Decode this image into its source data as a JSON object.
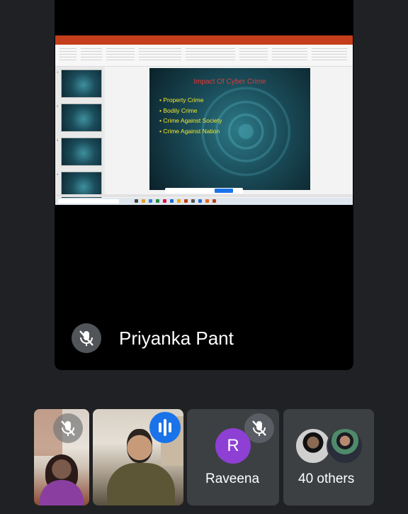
{
  "presenter": {
    "name": "Priyanka Pant",
    "mic_muted": true
  },
  "shared_screen": {
    "app": "PowerPoint",
    "slide": {
      "title": "Impact Of Cyber Crime",
      "bullets": [
        "Property Crime",
        "Bodily Crime",
        "Crime Against Society",
        "Crime Against Nation"
      ]
    },
    "thumbnails": [
      {
        "num": "1"
      },
      {
        "num": "2"
      },
      {
        "num": "3"
      },
      {
        "num": "4"
      }
    ]
  },
  "participants": [
    {
      "type": "photo",
      "mic_muted": true
    },
    {
      "type": "photo",
      "speaking": true
    },
    {
      "type": "initial",
      "initial": "R",
      "name": "Raveena",
      "mic_muted": true,
      "avatar_color": "#8e3fd4"
    },
    {
      "type": "group",
      "label": "40 others"
    }
  ],
  "colors": {
    "background": "#202124",
    "tile": "#3c4043",
    "speaking": "#1a73e8",
    "slide_title": "#e13a3a",
    "slide_text": "#f4ea2d"
  }
}
